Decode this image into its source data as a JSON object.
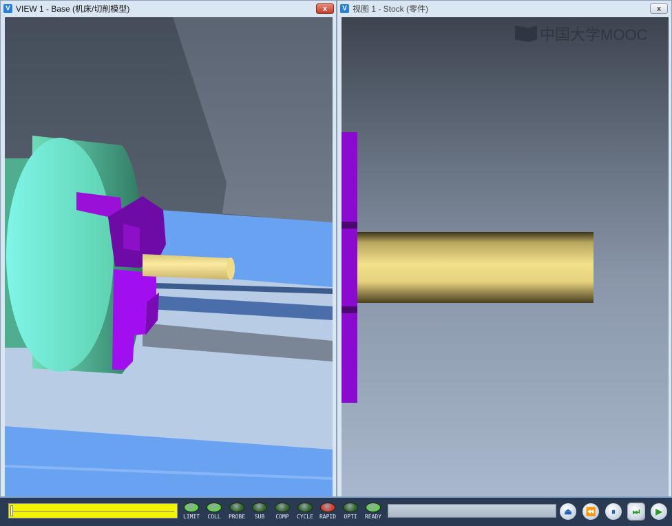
{
  "left_window": {
    "title": "VIEW 1 - Base (机床/切削模型)",
    "close_label": "x"
  },
  "right_window": {
    "title": "视图 1 - Stock (零件)",
    "close_label": "x",
    "watermark": "中国大学MOOC"
  },
  "toolbar": {
    "slider_position": 0,
    "lights": [
      {
        "label": "LIMIT",
        "color": "#5fd24a"
      },
      {
        "label": "COLL",
        "color": "#5fd24a"
      },
      {
        "label": "PROBE",
        "color": "#2f6a28"
      },
      {
        "label": "SUB",
        "color": "#2f6a28"
      },
      {
        "label": "COMP",
        "color": "#2f6a28"
      },
      {
        "label": "CYCLE",
        "color": "#2f6a28"
      },
      {
        "label": "RAPID",
        "color": "#e03a2a"
      },
      {
        "label": "OPTI",
        "color": "#2f6a28"
      },
      {
        "label": "READY",
        "color": "#5fd24a"
      }
    ],
    "buttons": [
      {
        "icon": "eject-icon",
        "glyph": "⏏"
      },
      {
        "icon": "rewind-icon",
        "glyph": "⏪"
      },
      {
        "icon": "pause-icon",
        "glyph": "⏸"
      },
      {
        "icon": "step-forward-icon",
        "glyph": "⏭"
      },
      {
        "icon": "play-icon",
        "glyph": "▶"
      }
    ]
  }
}
